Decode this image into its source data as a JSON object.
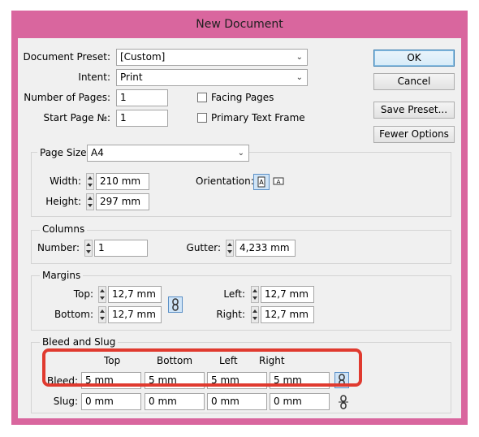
{
  "window": {
    "title": "New Document"
  },
  "preset": {
    "label": "Document Preset:",
    "value": "[Custom]"
  },
  "intent": {
    "label": "Intent:",
    "value": "Print"
  },
  "pages": {
    "number_label": "Number of Pages:",
    "number_value": "1",
    "start_label": "Start Page №:",
    "start_value": "1",
    "facing_label": "Facing Pages",
    "primary_label": "Primary Text Frame"
  },
  "buttons": {
    "ok": "OK",
    "cancel": "Cancel",
    "save_preset": "Save Preset...",
    "fewer_options": "Fewer Options"
  },
  "page_size": {
    "label": "Page Size:",
    "value": "A4",
    "width_label": "Width:",
    "width_value": "210 mm",
    "height_label": "Height:",
    "height_value": "297 mm",
    "orientation_label": "Orientation:"
  },
  "columns": {
    "title": "Columns",
    "number_label": "Number:",
    "number_value": "1",
    "gutter_label": "Gutter:",
    "gutter_value": "4,233 mm"
  },
  "margins": {
    "title": "Margins",
    "top_label": "Top:",
    "top_value": "12,7 mm",
    "bottom_label": "Bottom:",
    "bottom_value": "12,7 mm",
    "left_label": "Left:",
    "left_value": "12,7 mm",
    "right_label": "Right:",
    "right_value": "12,7 mm"
  },
  "bleed_slug": {
    "title": "Bleed and Slug",
    "headers": [
      "Top",
      "Bottom",
      "Left",
      "Right"
    ],
    "bleed_label": "Bleed:",
    "bleed_values": [
      "5 mm",
      "5 mm",
      "5 mm",
      "5 mm"
    ],
    "slug_label": "Slug:",
    "slug_values": [
      "0 mm",
      "0 mm",
      "0 mm",
      "0 mm"
    ]
  },
  "colors": {
    "window_frame": "#d9669e",
    "highlight": "#e03a2f"
  }
}
